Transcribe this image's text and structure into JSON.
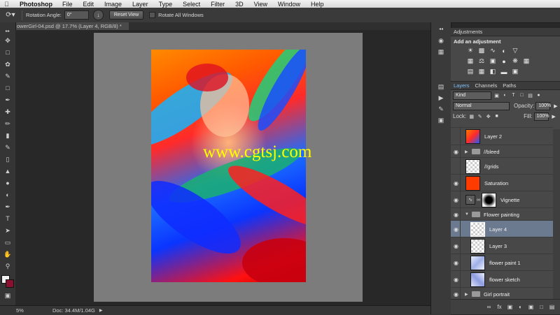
{
  "menubar": {
    "apple_icon": "apple-icon",
    "app_name": "Photoshop",
    "items": [
      "File",
      "Edit",
      "Image",
      "Layer",
      "Type",
      "Select",
      "Filter",
      "3D",
      "View",
      "Window",
      "Help"
    ]
  },
  "options": {
    "rotation_label": "Rotation Angle:",
    "rotation_value": "0°",
    "reset_view": "Reset View",
    "rotate_all_windows": "Rotate All Windows"
  },
  "document": {
    "tab_title": "owerGirl-04.psd @ 17.7% (Layer 4, RGB/8) *",
    "watermark": "www.cgtsj.com"
  },
  "status": {
    "zoom": "5%",
    "doc_info": "Doc: 34.4M/1.04G"
  },
  "adjustments": {
    "tab": "Adjustments",
    "title": "Add an adjustment"
  },
  "layers_panel": {
    "tabs": [
      "Layers",
      "Channels",
      "Paths"
    ],
    "filter_kind": "Kind",
    "blend_mode": "Normal",
    "opacity_label": "Opacity:",
    "opacity_value": "100%",
    "lock_label": "Lock:",
    "fill_label": "Fill:",
    "fill_value": "100%",
    "layers": [
      {
        "name": "Layer 2"
      },
      {
        "name": "//bleed"
      },
      {
        "name": "//grids"
      },
      {
        "name": "Saturation"
      },
      {
        "name": "Vignette"
      },
      {
        "name": "Flower painting"
      },
      {
        "name": "Layer 4"
      },
      {
        "name": "Layer 3"
      },
      {
        "name": "flower paint 1"
      },
      {
        "name": "flower sketch"
      },
      {
        "name": "Girl portrait"
      }
    ]
  },
  "colors": {
    "accent_tab": "#7fc1ff",
    "selected_layer": "#6c7a8f",
    "saturation_fill": "#ff3b00",
    "watermark": "#ffff00"
  }
}
